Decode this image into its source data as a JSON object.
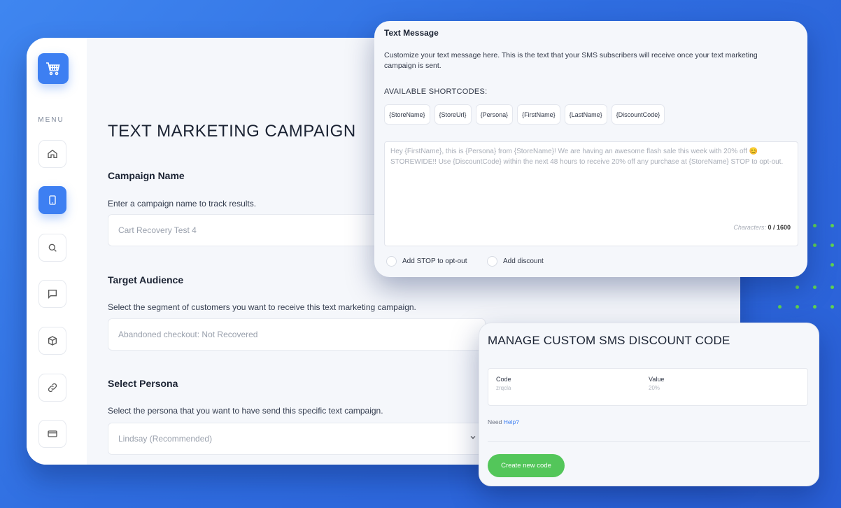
{
  "app": {
    "menu_label": "MENU",
    "nav": [
      {
        "icon": "home-icon"
      },
      {
        "icon": "tablet-icon",
        "active": true
      },
      {
        "icon": "search-icon"
      },
      {
        "icon": "chat-icon"
      },
      {
        "icon": "box-icon"
      },
      {
        "icon": "link-icon"
      },
      {
        "icon": "card-icon"
      }
    ],
    "logo_icon": "shopping-cart-icon",
    "accent": "#3d7ff2"
  },
  "main": {
    "title": "TEXT MARKETING CAMPAIGN",
    "campaign": {
      "title": "Campaign Name",
      "desc": "Enter a campaign name to track results.",
      "value": "Cart Recovery Test 4"
    },
    "audience": {
      "title": "Target Audience",
      "desc": "Select the segment of customers you want to receive this text marketing campaign.",
      "value": "Abandoned checkout: Not Recovered"
    },
    "persona": {
      "title": "Select Persona",
      "desc": "Select the persona that you want to have send this specific text campaign.",
      "value": "Lindsay (Recommended)"
    }
  },
  "text_message": {
    "title": "Text Message",
    "desc": "Customize your text message here. This is the text that your SMS subscribers will receive once your text marketing campaign is sent.",
    "shortcodes_label": "AVAILABLE SHORTCODES:",
    "shortcodes": [
      "{StoreName}",
      "{StoreUrl}",
      "{Persona}",
      "{FirstName}",
      "{LastName}",
      "{DiscountCode}"
    ],
    "body": "Hey {FirstName}, this is {Persona} from {StoreName}! We are having an awesome flash sale this week with 20% off 😊 STOREWIDE!! Use {DiscountCode} within the next 48 hours to receive 20% off any purchase at {StoreName} STOP to opt-out.",
    "char_label": "Characters:",
    "char_count": "0 / 1600",
    "opt_stop": "Add STOP to opt-out",
    "opt_discount": "Add discount"
  },
  "discount": {
    "title": "MANAGE CUSTOM SMS DISCOUNT CODE",
    "code_header": "Code",
    "code_value": "zrqcla",
    "value_header": "Value",
    "value_value": "20%",
    "help_prefix": "Need",
    "help_link": "Help?",
    "create_button": "Create new code",
    "button_color": "#53c65a"
  }
}
